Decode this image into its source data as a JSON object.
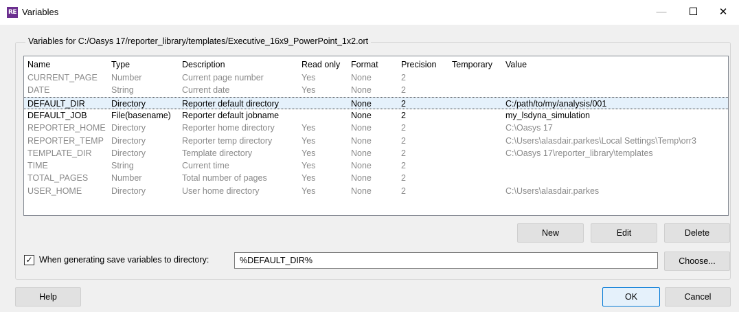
{
  "window": {
    "icon_text": "RE",
    "title": "Variables",
    "minimize": "—",
    "close": "✕"
  },
  "group": {
    "title": "Variables for C:/Oasys 17/reporter_library/templates/Executive_16x9_PowerPoint_1x2.ort"
  },
  "table": {
    "columns": [
      "Name",
      "Type",
      "Description",
      "Read only",
      "Format",
      "Precision",
      "Temporary",
      "Value"
    ],
    "rows": [
      {
        "name": "CURRENT_PAGE",
        "type": "Number",
        "description": "Current page number",
        "read_only": "Yes",
        "format": "None",
        "precision": "2",
        "temporary": "",
        "value": "",
        "style": "grey"
      },
      {
        "name": "DATE",
        "type": "String",
        "description": "Current date",
        "read_only": "Yes",
        "format": "None",
        "precision": "2",
        "temporary": "",
        "value": "",
        "style": "grey"
      },
      {
        "name": "DEFAULT_DIR",
        "type": "Directory",
        "description": "Reporter default directory",
        "read_only": "",
        "format": "None",
        "precision": "2",
        "temporary": "",
        "value": "C:/path/to/my/analysis/001",
        "style": "selected"
      },
      {
        "name": "DEFAULT_JOB",
        "type": "File(basename)",
        "description": "Reporter default jobname",
        "read_only": "",
        "format": "None",
        "precision": "2",
        "temporary": "",
        "value": "my_lsdyna_simulation",
        "style": "dark"
      },
      {
        "name": "REPORTER_HOME",
        "type": "Directory",
        "description": "Reporter home directory",
        "read_only": "Yes",
        "format": "None",
        "precision": "2",
        "temporary": "",
        "value": "C:\\Oasys 17",
        "style": "grey"
      },
      {
        "name": "REPORTER_TEMP",
        "type": "Directory",
        "description": "Reporter temp directory",
        "read_only": "Yes",
        "format": "None",
        "precision": "2",
        "temporary": "",
        "value": "C:\\Users\\alasdair.parkes\\Local Settings\\Temp\\orr3",
        "style": "grey"
      },
      {
        "name": "TEMPLATE_DIR",
        "type": "Directory",
        "description": "Template directory",
        "read_only": "Yes",
        "format": "None",
        "precision": "2",
        "temporary": "",
        "value": "C:\\Oasys 17\\reporter_library\\templates",
        "style": "grey"
      },
      {
        "name": "TIME",
        "type": "String",
        "description": "Current time",
        "read_only": "Yes",
        "format": "None",
        "precision": "2",
        "temporary": "",
        "value": "",
        "style": "grey"
      },
      {
        "name": "TOTAL_PAGES",
        "type": "Number",
        "description": "Total number of pages",
        "read_only": "Yes",
        "format": "None",
        "precision": "2",
        "temporary": "",
        "value": "",
        "style": "grey"
      },
      {
        "name": "USER_HOME",
        "type": "Directory",
        "description": "User home directory",
        "read_only": "Yes",
        "format": "None",
        "precision": "2",
        "temporary": "",
        "value": "C:\\Users\\alasdair.parkes",
        "style": "grey"
      }
    ]
  },
  "actions": {
    "new": "New",
    "edit": "Edit",
    "delete": "Delete"
  },
  "save_option": {
    "checked": true,
    "check_mark": "✓",
    "label": "When generating save variables to directory:",
    "directory": "%DEFAULT_DIR%",
    "choose": "Choose..."
  },
  "footer": {
    "help": "Help",
    "ok": "OK",
    "cancel": "Cancel"
  }
}
